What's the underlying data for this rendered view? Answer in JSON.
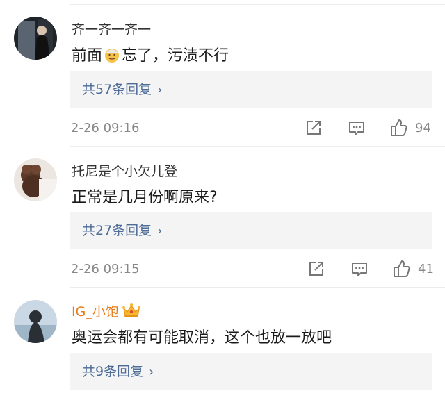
{
  "comments": [
    {
      "username": "齐一齐一齐一",
      "text_before": "前面",
      "emoji": "old-man-emoji",
      "text_after": "忘了，污渍不行",
      "reply_label": "共57条回复",
      "timestamp": "2-26 09:16",
      "likes": "94"
    },
    {
      "username": "托尼是个小欠儿登",
      "text": "正常是几月份啊原来?",
      "reply_label": "共27条回复",
      "timestamp": "2-26 09:15",
      "likes": "41"
    },
    {
      "username": "IG_小饱",
      "badge": "crown-icon",
      "text": "奥运会都有可能取消，这个也放一放吧",
      "reply_label": "共9条回复"
    }
  ],
  "colors": {
    "link": "#4c6b97",
    "vip_name": "#e87b1a",
    "meta": "#888888"
  }
}
